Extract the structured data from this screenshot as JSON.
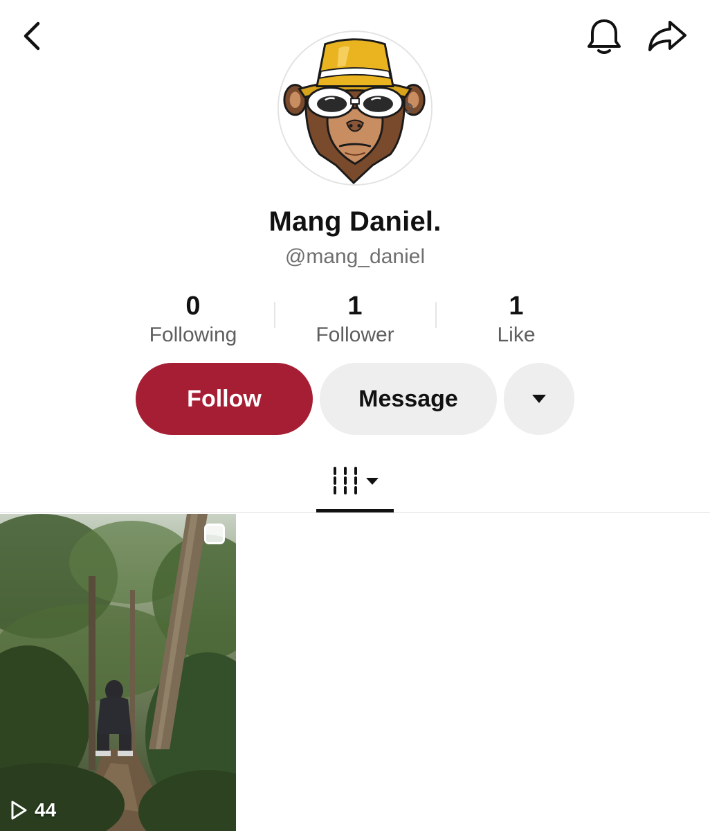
{
  "profile": {
    "display_name": "Mang Daniel.",
    "handle": "@mang_daniel"
  },
  "stats": {
    "following": {
      "value": "0",
      "label": "Following"
    },
    "followers": {
      "value": "1",
      "label": "Follower"
    },
    "likes": {
      "value": "1",
      "label": "Like"
    }
  },
  "actions": {
    "follow_label": "Follow",
    "message_label": "Message"
  },
  "videos": [
    {
      "views": "44"
    }
  ],
  "icons": {
    "back": "chevron-left-icon",
    "notifications": "bell-icon",
    "share": "share-arrow-icon",
    "more": "caret-down-icon",
    "videos_tab": "grid-icon",
    "views": "play-icon"
  },
  "colors": {
    "follow_button": "#a61e33",
    "secondary_button": "#eeeeee",
    "secondary_text": "#6f6f6f"
  }
}
